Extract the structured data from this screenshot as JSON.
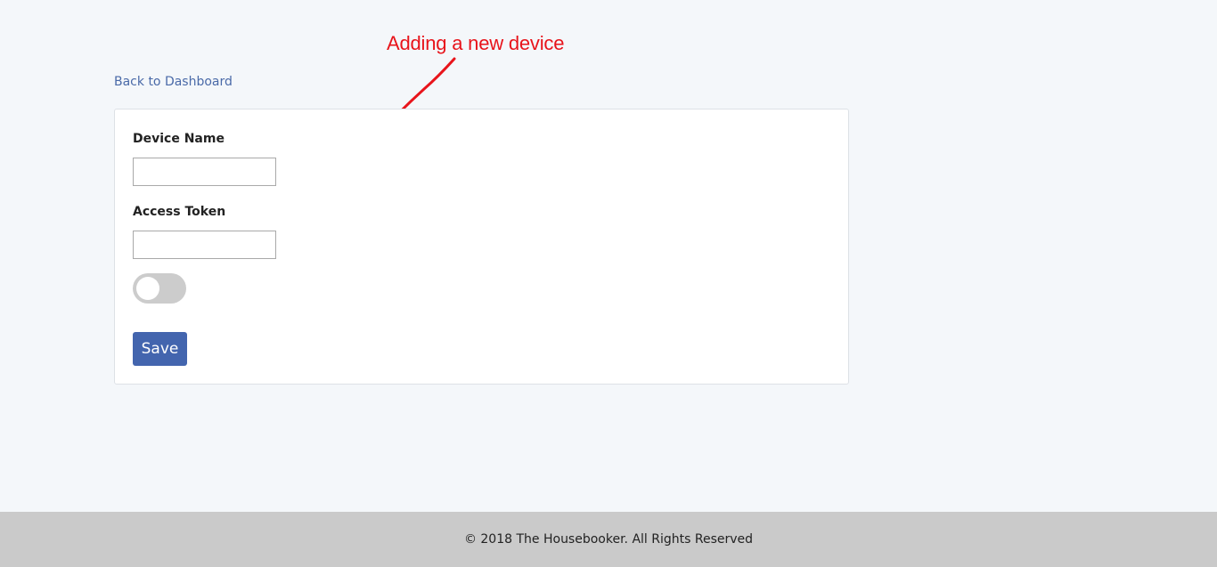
{
  "annotation": {
    "text": "Adding a new device",
    "color": "#e8141b"
  },
  "navigation": {
    "back_link_label": "Back to Dashboard"
  },
  "form": {
    "device_name": {
      "label": "Device Name",
      "value": "",
      "placeholder": ""
    },
    "access_token": {
      "label": "Access Token",
      "value": "",
      "placeholder": ""
    },
    "toggle": {
      "state": "off"
    },
    "save_label": "Save"
  },
  "footer": {
    "text": "© 2018 The Housebooker. All Rights Reserved"
  },
  "colors": {
    "background": "#f4f7fa",
    "link": "#4a6aa8",
    "primary_button": "#4365ae",
    "footer": "#cacaca",
    "toggle_off": "#cccccc"
  }
}
